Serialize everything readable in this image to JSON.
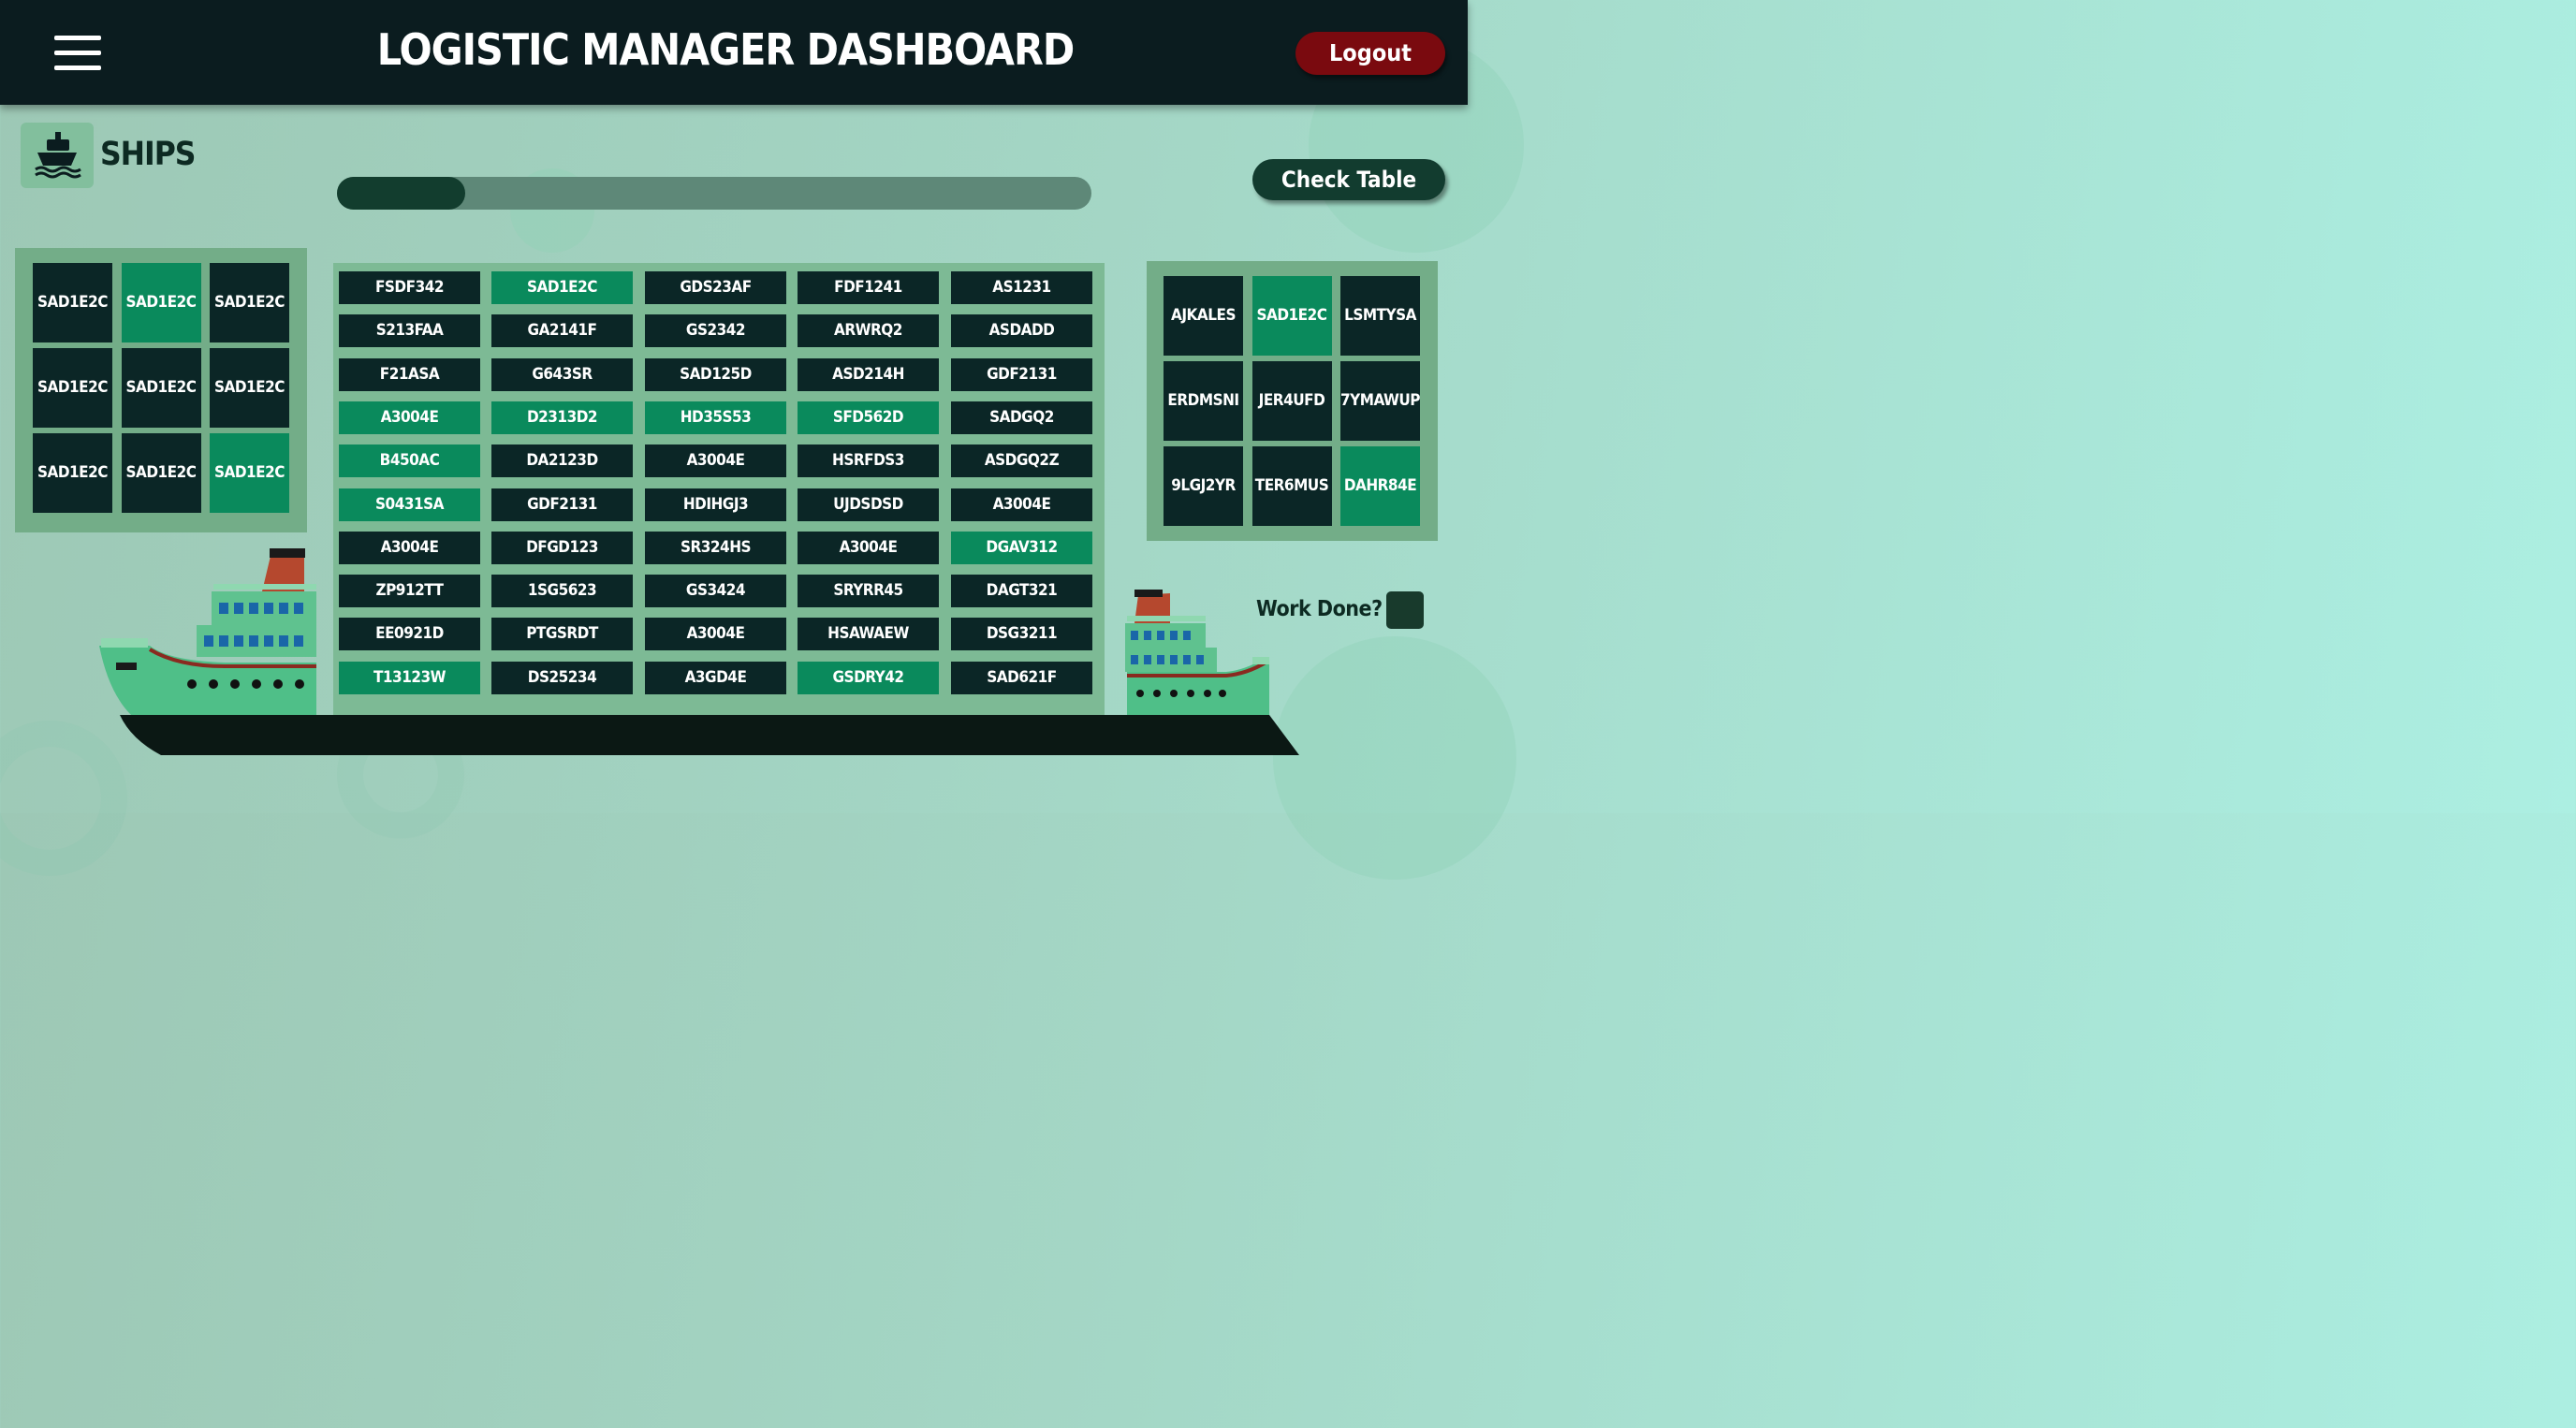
{
  "header": {
    "title": "LOGISTIC MANAGER DASHBOARD",
    "logout_label": "Logout"
  },
  "ships_label": "SHIPS",
  "progress": {
    "fraction": 0.17
  },
  "check_table_label": "Check Table",
  "work_done_label": "Work Done?",
  "colors": {
    "dark_cell": "#0b2626",
    "green_cell": "#0a8a5c",
    "panel": "#73ad88",
    "logout": "#7a0a0f",
    "header": "#0b1c1f"
  },
  "left_grid": [
    [
      {
        "label": "SAD1E2C",
        "state": "dark"
      },
      {
        "label": "SAD1E2C",
        "state": "green"
      },
      {
        "label": "SAD1E2C",
        "state": "dark"
      }
    ],
    [
      {
        "label": "SAD1E2C",
        "state": "dark"
      },
      {
        "label": "SAD1E2C",
        "state": "dark"
      },
      {
        "label": "SAD1E2C",
        "state": "dark"
      }
    ],
    [
      {
        "label": "SAD1E2C",
        "state": "dark"
      },
      {
        "label": "SAD1E2C",
        "state": "dark"
      },
      {
        "label": "SAD1E2C",
        "state": "green"
      }
    ]
  ],
  "ship_bays": [
    [
      {
        "label": "FSDF342",
        "state": "dark"
      },
      {
        "label": "SAD1E2C",
        "state": "green"
      },
      {
        "label": "GDS23AF",
        "state": "dark"
      },
      {
        "label": "FDF1241",
        "state": "dark"
      },
      {
        "label": "AS1231",
        "state": "dark"
      }
    ],
    [
      {
        "label": "S213FAA",
        "state": "dark"
      },
      {
        "label": "GA2141F",
        "state": "dark"
      },
      {
        "label": "GS2342",
        "state": "dark"
      },
      {
        "label": "ARWRQ2",
        "state": "dark"
      },
      {
        "label": "ASDADD",
        "state": "dark"
      }
    ],
    [
      {
        "label": "F21ASA",
        "state": "dark"
      },
      {
        "label": "G643SR",
        "state": "dark"
      },
      {
        "label": "SAD125D",
        "state": "dark"
      },
      {
        "label": "ASD214H",
        "state": "dark"
      },
      {
        "label": "GDF2131",
        "state": "dark"
      }
    ],
    [
      {
        "label": "A3004E",
        "state": "green"
      },
      {
        "label": "D2313D2",
        "state": "green"
      },
      {
        "label": "HD35S53",
        "state": "green"
      },
      {
        "label": "SFD562D",
        "state": "green"
      },
      {
        "label": "SADGQ2",
        "state": "dark"
      }
    ],
    [
      {
        "label": "B450AC",
        "state": "green"
      },
      {
        "label": "DA2123D",
        "state": "dark"
      },
      {
        "label": "A3004E",
        "state": "dark"
      },
      {
        "label": "HSRFDS3",
        "state": "dark"
      },
      {
        "label": "ASDGQ2Z",
        "state": "dark"
      }
    ],
    [
      {
        "label": "S0431SA",
        "state": "green"
      },
      {
        "label": "GDF2131",
        "state": "dark"
      },
      {
        "label": "HDIHGJ3",
        "state": "dark"
      },
      {
        "label": "UJDSDSD",
        "state": "dark"
      },
      {
        "label": "A3004E",
        "state": "dark"
      }
    ],
    [
      {
        "label": "A3004E",
        "state": "dark"
      },
      {
        "label": "DFGD123",
        "state": "dark"
      },
      {
        "label": "SR324HS",
        "state": "dark"
      },
      {
        "label": "A3004E",
        "state": "dark"
      },
      {
        "label": "DGAV312",
        "state": "green"
      }
    ],
    [
      {
        "label": "ZP912TT",
        "state": "dark"
      },
      {
        "label": "1SG5623",
        "state": "dark"
      },
      {
        "label": "GS3424",
        "state": "dark"
      },
      {
        "label": "SRYRR45",
        "state": "dark"
      },
      {
        "label": "DAGT321",
        "state": "dark"
      }
    ],
    [
      {
        "label": "EE0921D",
        "state": "dark"
      },
      {
        "label": "PTGSRDT",
        "state": "dark"
      },
      {
        "label": "A3004E",
        "state": "dark"
      },
      {
        "label": "HSAWAEW",
        "state": "dark"
      },
      {
        "label": "DSG3211",
        "state": "dark"
      }
    ],
    [
      {
        "label": "T13123W",
        "state": "green"
      },
      {
        "label": "DS25234",
        "state": "dark"
      },
      {
        "label": "A3GD4E",
        "state": "dark"
      },
      {
        "label": "GSDRY42",
        "state": "green"
      },
      {
        "label": "SAD621F",
        "state": "dark"
      }
    ]
  ],
  "right_grid": [
    [
      {
        "label": "AJKALES",
        "state": "dark"
      },
      {
        "label": "SAD1E2C",
        "state": "green"
      },
      {
        "label": "LSMTYSA",
        "state": "dark"
      }
    ],
    [
      {
        "label": "ERDMSNI",
        "state": "dark"
      },
      {
        "label": "JER4UFD",
        "state": "dark"
      },
      {
        "label": "7YMAWUP",
        "state": "dark"
      }
    ],
    [
      {
        "label": "9LGJ2YR",
        "state": "dark"
      },
      {
        "label": "TER6MUS",
        "state": "dark"
      },
      {
        "label": "DAHR84E",
        "state": "green"
      }
    ]
  ]
}
